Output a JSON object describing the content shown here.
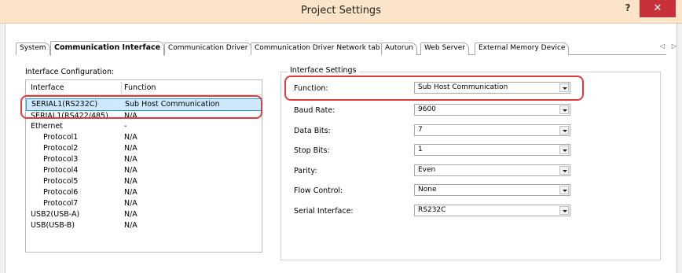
{
  "window": {
    "title": "Project Settings",
    "help_label": "?",
    "close_label": "✕"
  },
  "tabs": [
    {
      "label": "System",
      "active": false
    },
    {
      "label": "Communication Interface",
      "active": true
    },
    {
      "label": "Communication Driver",
      "active": false
    },
    {
      "label": "Communication Driver Network tab",
      "active": false
    },
    {
      "label": "Autorun",
      "active": false
    },
    {
      "label": "Web Server",
      "active": false
    },
    {
      "label": "External Memory Device",
      "active": false
    }
  ],
  "tab_scroll": "◁ ▷",
  "interface_configuration": {
    "label": "Interface Configuration:",
    "columns": [
      "Interface",
      "Function"
    ],
    "rows": [
      {
        "interface": "SERIAL1(RS232C)",
        "function": "Sub Host Communication",
        "selected": true
      },
      {
        "interface": "SERIAL1(RS422/485)",
        "function": "N/A"
      },
      {
        "interface": "Ethernet",
        "function": "-"
      },
      {
        "interface": "Protocol1",
        "function": "N/A"
      },
      {
        "interface": "Protocol2",
        "function": "N/A"
      },
      {
        "interface": "Protocol3",
        "function": "N/A"
      },
      {
        "interface": "Protocol4",
        "function": "N/A"
      },
      {
        "interface": "Protocol5",
        "function": "N/A"
      },
      {
        "interface": "Protocol6",
        "function": "N/A"
      },
      {
        "interface": "Protocol7",
        "function": "N/A"
      },
      {
        "interface": "USB2(USB-A)",
        "function": "N/A"
      },
      {
        "interface": "USB(USB-B)",
        "function": "N/A"
      }
    ]
  },
  "interface_settings": {
    "title": "Interface Settings",
    "fields": [
      {
        "label": "Function:",
        "value": "Sub Host Communication"
      },
      {
        "label": "Baud Rate:",
        "value": "9600"
      },
      {
        "label": "Data Bits:",
        "value": "7"
      },
      {
        "label": "Stop Bits:",
        "value": "1"
      },
      {
        "label": "Parity:",
        "value": "Even"
      },
      {
        "label": "Flow Control:",
        "value": "None"
      },
      {
        "label": "Serial Interface:",
        "value": "RS232C"
      }
    ]
  },
  "colors": {
    "title_bar": "#fbe4c8",
    "close_button": "#c7313a",
    "selection": "#cde8ff",
    "highlight_annotation": "#e03a3a"
  }
}
